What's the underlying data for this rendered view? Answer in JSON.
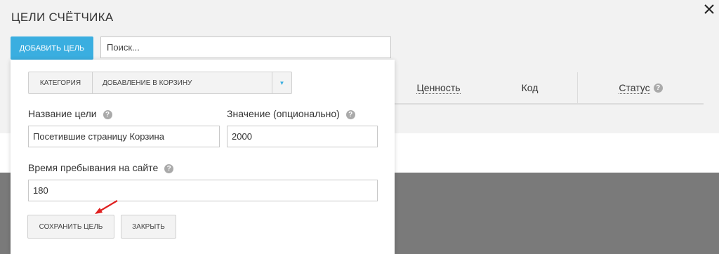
{
  "dialog": {
    "title": "ЦЕЛИ СЧЁТЧИКА",
    "close_icon": "close-icon"
  },
  "toolbar": {
    "add_goal_label": "ДОБАВИТЬ ЦЕЛЬ",
    "search_placeholder": "Поиск..."
  },
  "table": {
    "columns": [
      {
        "label": "Ценность"
      },
      {
        "label": "Код"
      },
      {
        "label": "Статус"
      }
    ]
  },
  "form": {
    "category_label": "КАТЕГОРИЯ",
    "category_value": "ДОБАВЛЕНИЕ В КОРЗИНУ",
    "goal_name_label": "Название цели",
    "goal_name_value": "Посетившие страницу Корзина",
    "value_label": "Значение (опционально)",
    "value_value": "2000",
    "time_label": "Время пребывания на сайте",
    "time_value": "180",
    "save_label": "СОХРАНИТЬ ЦЕЛЬ",
    "close_label": "ЗАКРЫТЬ"
  },
  "colors": {
    "accent": "#3aaee0",
    "annotation_arrow": "#e02020"
  }
}
